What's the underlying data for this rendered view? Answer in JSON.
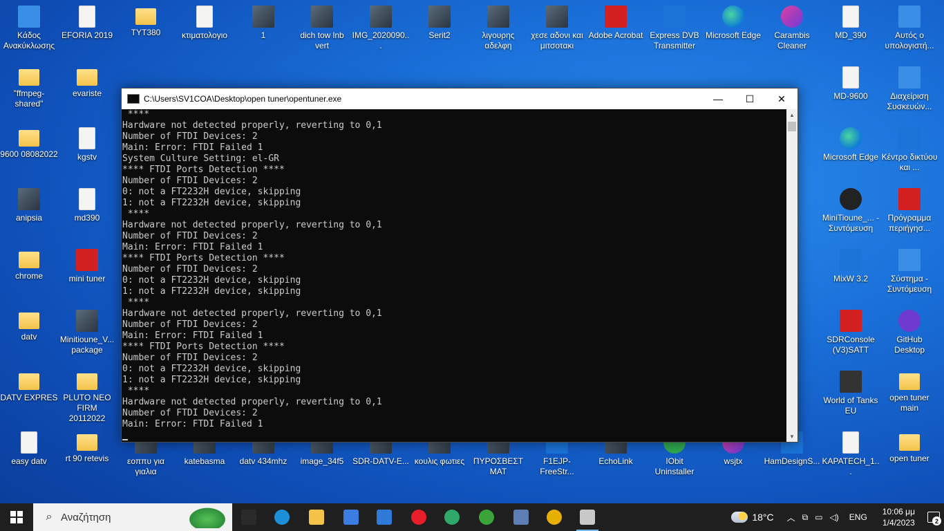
{
  "desktop": {
    "icons": [
      {
        "label": "Κάδος Ανακύκλωσης",
        "kind": "g-pc",
        "icon": "recycle-bin-icon"
      },
      {
        "label": "EFORIA 2019",
        "kind": "g-file",
        "icon": "document-icon"
      },
      {
        "label": "TYT380",
        "kind": "g-folder",
        "icon": "folder-icon"
      },
      {
        "label": "κτιματολογιο",
        "kind": "g-file",
        "icon": "document-icon"
      },
      {
        "label": "1",
        "kind": "g-img",
        "icon": "image-icon"
      },
      {
        "label": "dich tow lnb vert",
        "kind": "g-img",
        "icon": "image-icon"
      },
      {
        "label": "IMG_2020090...",
        "kind": "g-img",
        "icon": "image-icon"
      },
      {
        "label": "Serit2",
        "kind": "g-img",
        "icon": "image-icon"
      },
      {
        "label": "λιγουρης αδελφη",
        "kind": "g-img",
        "icon": "image-icon"
      },
      {
        "label": "χεσε αδονι και μιτσοτακι",
        "kind": "g-img",
        "icon": "image-icon"
      },
      {
        "label": "Adobe Acrobat",
        "kind": "g-red",
        "icon": "acrobat-icon"
      },
      {
        "label": "Express DVB Transmitter",
        "kind": "g-blue",
        "icon": "tv-icon"
      },
      {
        "label": "Microsoft Edge",
        "kind": "g-edge",
        "icon": "edge-icon"
      },
      {
        "label": "Carambis Cleaner",
        "kind": "g-pink",
        "icon": "cleaner-icon"
      },
      {
        "label": "MD_390",
        "kind": "g-file",
        "icon": "document-icon"
      },
      {
        "label": "Αυτός ο υπολογιστή...",
        "kind": "g-pc",
        "icon": "computer-icon"
      },
      {
        "label": "\"ffmpeg-shared\"",
        "kind": "g-folder",
        "icon": "folder-icon"
      },
      {
        "label": "evariste",
        "kind": "g-folder",
        "icon": "folder-icon"
      },
      {
        "label": "MD-9600",
        "kind": "g-file",
        "icon": "radio-icon"
      },
      {
        "label": "Διαχείριση Συσκευών...",
        "kind": "g-pc",
        "icon": "device-manager-icon"
      },
      {
        "label": "9600 08082022",
        "kind": "g-folder",
        "icon": "folder-icon"
      },
      {
        "label": "kgstv",
        "kind": "g-file",
        "icon": "document-icon"
      },
      {
        "label": "Microsoft Edge",
        "kind": "g-edge",
        "icon": "edge-icon"
      },
      {
        "label": "Κέντρο δικτύου και ...",
        "kind": "g-blue",
        "icon": "network-icon"
      },
      {
        "label": "anipsia",
        "kind": "g-img",
        "icon": "image-icon"
      },
      {
        "label": "md390",
        "kind": "g-file",
        "icon": "document-icon"
      },
      {
        "label": "MiniTioune_... - Συντόμευση",
        "kind": "g-dark",
        "icon": "minitioune-icon"
      },
      {
        "label": "Πρόγραμμα περιήγησ...",
        "kind": "g-red",
        "icon": "opera-icon"
      },
      {
        "label": "chrome",
        "kind": "g-folder",
        "icon": "folder-icon"
      },
      {
        "label": "mini tuner",
        "kind": "g-red",
        "icon": "mini-tuner-icon"
      },
      {
        "label": "MixW 3.2",
        "kind": "g-blue",
        "icon": "butterfly-icon"
      },
      {
        "label": "Σύστημα - Συντόμευση",
        "kind": "g-pc",
        "icon": "system-icon"
      },
      {
        "label": "datv",
        "kind": "g-folder",
        "icon": "folder-icon"
      },
      {
        "label": "Minitioune_V... package",
        "kind": "g-img",
        "icon": "archive-icon"
      },
      {
        "label": "SDRConsole (V3)SATT",
        "kind": "g-red",
        "icon": "sdr-console-icon"
      },
      {
        "label": "GitHub Desktop",
        "kind": "g-purple",
        "icon": "github-icon"
      },
      {
        "label": "DATV EXPRES",
        "kind": "g-folder",
        "icon": "folder-icon"
      },
      {
        "label": "PLUTO NEO FIRM 20112022",
        "kind": "g-folder",
        "icon": "folder-icon"
      },
      {
        "label": "World of Tanks EU",
        "kind": "g-tank",
        "icon": "world-of-tanks-icon"
      },
      {
        "label": "open tuner main",
        "kind": "g-folder",
        "icon": "folder-icon"
      },
      {
        "label": "easy datv",
        "kind": "g-file",
        "icon": "document-icon"
      },
      {
        "label": "rt 90 retevis",
        "kind": "g-folder",
        "icon": "folder-icon"
      },
      {
        "label": "εοππυ για γιαλια",
        "kind": "g-img",
        "icon": "image-icon"
      },
      {
        "label": "katebasma",
        "kind": "g-img",
        "icon": "image-icon"
      },
      {
        "label": "datv 434mhz",
        "kind": "g-img",
        "icon": "image-icon"
      },
      {
        "label": "image_34f5",
        "kind": "g-img",
        "icon": "image-icon"
      },
      {
        "label": "SDR-DATV-E...",
        "kind": "g-img",
        "icon": "image-icon"
      },
      {
        "label": "κουλις φωτιες",
        "kind": "g-img",
        "icon": "image-icon"
      },
      {
        "label": "ΠΥΡΟΣΒΕΣΤ ΜΑΤ",
        "kind": "g-img",
        "icon": "image-icon"
      },
      {
        "label": "F1EJP-FreeStr...",
        "kind": "g-blue",
        "icon": "satellite-icon"
      },
      {
        "label": "EchoLink",
        "kind": "g-img",
        "icon": "echolink-icon"
      },
      {
        "label": "IObit Uninstaller",
        "kind": "g-green",
        "icon": "iobit-icon"
      },
      {
        "label": "wsjtx",
        "kind": "g-pink",
        "icon": "wsjtx-icon"
      },
      {
        "label": "HamDesignS...",
        "kind": "g-blue",
        "icon": "hamdesign-icon"
      },
      {
        "label": "KAPATECH_1...",
        "kind": "g-file",
        "icon": "document-icon"
      },
      {
        "label": "open tuner",
        "kind": "g-folder",
        "icon": "folder-icon"
      }
    ]
  },
  "console": {
    "title": "C:\\Users\\SV1COA\\Desktop\\open tuner\\opentuner.exe",
    "lines": [
      " ****",
      "Hardware not detected properly, reverting to 0,1",
      "Number of FTDI Devices: 2",
      "Main: Error: FTDI Failed 1",
      "System Culture Setting: el-GR",
      "**** FTDI Ports Detection ****",
      "Number of FTDI Devices: 2",
      "0: not a FT2232H device, skipping",
      "1: not a FT2232H device, skipping",
      " ****",
      "Hardware not detected properly, reverting to 0,1",
      "Number of FTDI Devices: 2",
      "Main: Error: FTDI Failed 1",
      "**** FTDI Ports Detection ****",
      "Number of FTDI Devices: 2",
      "0: not a FT2232H device, skipping",
      "1: not a FT2232H device, skipping",
      " ****",
      "Hardware not detected properly, reverting to 0,1",
      "Number of FTDI Devices: 2",
      "Main: Error: FTDI Failed 1",
      "**** FTDI Ports Detection ****",
      "Number of FTDI Devices: 2",
      "0: not a FT2232H device, skipping",
      "1: not a FT2232H device, skipping",
      " ****",
      "Hardware not detected properly, reverting to 0,1",
      "Number of FTDI Devices: 2",
      "Main: Error: FTDI Failed 1"
    ],
    "minimize_glyph": "—",
    "maximize_glyph": "☐",
    "close_glyph": "✕"
  },
  "taskbar": {
    "search_placeholder": "Αναζήτηση",
    "apps": [
      {
        "name": "task-view-icon",
        "color": "#2b2b2b"
      },
      {
        "name": "edge-icon",
        "color": "#1b8fd8"
      },
      {
        "name": "file-explorer-icon",
        "color": "#f3c34a"
      },
      {
        "name": "store-icon",
        "color": "#3b7de0"
      },
      {
        "name": "mail-icon",
        "color": "#2f7ad6"
      },
      {
        "name": "opera-icon",
        "color": "#e81e2b"
      },
      {
        "name": "vpn-icon",
        "color": "#2fa86a"
      },
      {
        "name": "upwork-icon",
        "color": "#3aa43a"
      },
      {
        "name": "snipping-icon",
        "color": "#5d7fb3"
      },
      {
        "name": "chrome-icon",
        "color": "#e6b000"
      },
      {
        "name": "console-app-icon",
        "color": "#c8c8c8"
      }
    ],
    "temperature": "18°C",
    "language": "ENG",
    "time": "10:06 μμ",
    "date": "1/4/2023",
    "notification_count": "2"
  }
}
